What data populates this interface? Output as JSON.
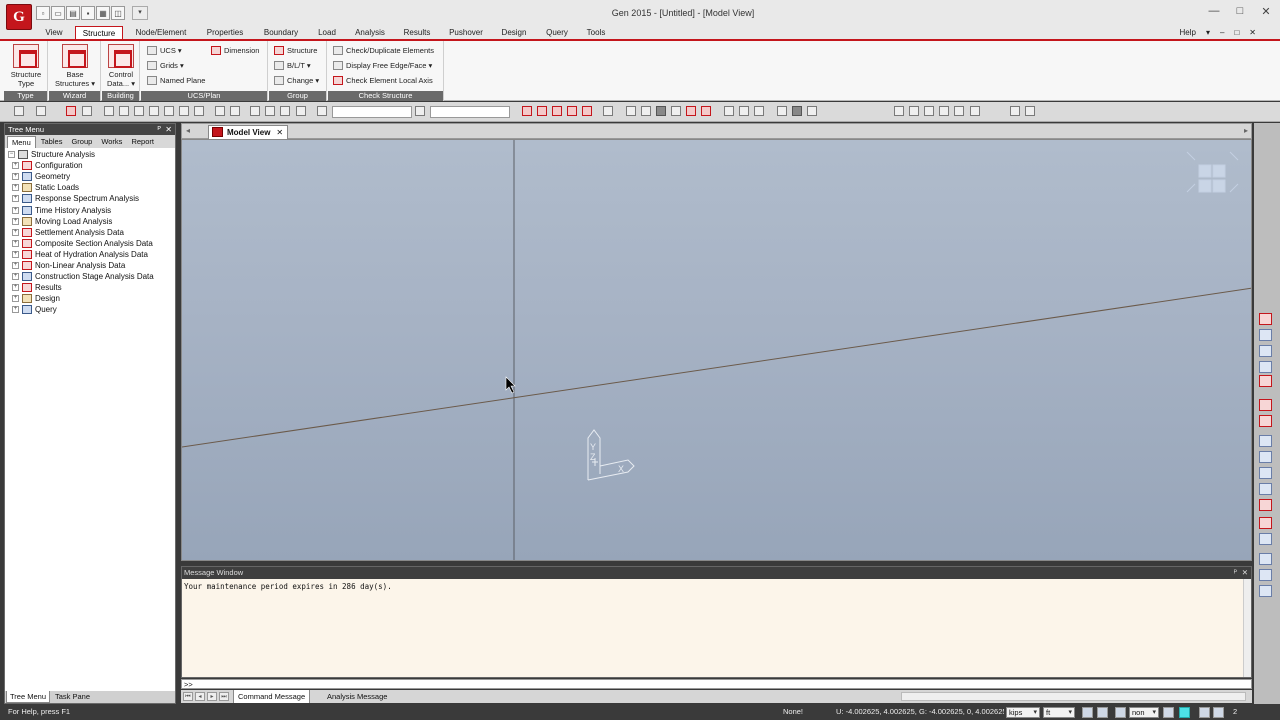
{
  "title": {
    "logo_text": "G",
    "text": "Gen 2015 - [Untitled] - [Model View]",
    "controls": [
      "—",
      "□",
      "✕"
    ]
  },
  "ribbon_tabs": [
    "View",
    "Structure",
    "Node/Element",
    "Properties",
    "Boundary",
    "Load",
    "Analysis",
    "Results",
    "Pushover",
    "Design",
    "Query",
    "Tools"
  ],
  "active_ribbon_tab": "Structure",
  "help": {
    "label": "Help",
    "extra": [
      "▾",
      "–",
      "□",
      "✕"
    ]
  },
  "ribbon": {
    "type_group": {
      "label": "Type",
      "button_line1": "Structure",
      "button_line2": "Type"
    },
    "wizard_group": {
      "label": "Wizard",
      "button_line1": "Base",
      "button_line2": "Structures ▾"
    },
    "building_group": {
      "label": "Building",
      "button_line1": "Control",
      "button_line2": "Data... ▾"
    },
    "ucs_group": {
      "label": "UCS/Plan",
      "ucs": "UCS ▾",
      "grids": "Grids ▾",
      "named_plane": "Named Plane",
      "dimension": "Dimension"
    },
    "group_group": {
      "label": "Group",
      "structure": "Structure",
      "blt": "B/L/T ▾",
      "change": "Change ▾"
    },
    "check_group": {
      "label": "Check Structure",
      "check_dup": "Check/Duplicate Elements",
      "free_edge": "Display Free Edge/Face ▾",
      "local_axis": "Check Element Local Axis"
    }
  },
  "tree": {
    "header": "Tree Menu",
    "tabs": [
      "Menu",
      "Tables",
      "Group",
      "Works",
      "Report"
    ],
    "active_tab": "Menu",
    "root": "Structure Analysis",
    "items": [
      "Configuration",
      "Geometry",
      "Static Loads",
      "Response Spectrum Analysis",
      "Time History Analysis",
      "Moving Load Analysis",
      "Settlement Analysis Data",
      "Composite Section Analysis Data",
      "Heat of Hydration Analysis Data",
      "Non-Linear Analysis Data",
      "Construction Stage Analysis Data",
      "Results",
      "Design",
      "Query"
    ],
    "bottom_tabs": [
      "Tree Menu",
      "Task Pane"
    ]
  },
  "model_view": {
    "tab_label": "Model View",
    "close": "✕",
    "axes": {
      "y": "Y",
      "z": "Z",
      "x": "X"
    }
  },
  "message_window": {
    "header": "Message Window",
    "text": "Your maintenance period expires in 286 day(s).",
    "prompt": ">>",
    "tabs": [
      "Command Message",
      "Analysis Message"
    ]
  },
  "status_bar": {
    "help_text": "For Help, press F1",
    "selection": "None!",
    "coords": "U: -4.002625, 4.002625, G: -4.002625, 0, 4.002625",
    "force_unit": "kips",
    "length_unit": "ft",
    "view_option": "non",
    "page": "2"
  },
  "colors": {
    "accent": "#c4161c",
    "model_bg_top": "#b0bccc",
    "model_bg_bottom": "#97a5b9",
    "message_bg": "#fcf5ea"
  }
}
